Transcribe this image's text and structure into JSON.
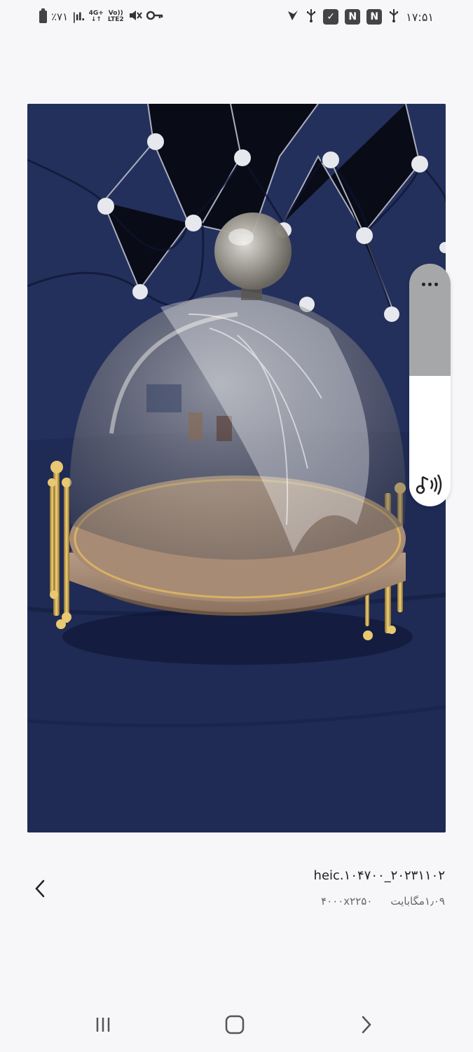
{
  "status_bar": {
    "battery_text": "٪۷۱",
    "net_top": "4G+",
    "net_bottom": "↓↑",
    "volte_top": "Vo))",
    "volte_bottom": "LTE2",
    "time": "۱۷:۵۱"
  },
  "photo": {
    "description_icon": "glass-cloche-photo"
  },
  "side_panel": {
    "more_icon": "more-horiz-icon",
    "sound_icon": "sound-shot-icon"
  },
  "file_info": {
    "filename": "heic.۱۰۴۷۰۰_۲۰۲۳۱۱۰۲",
    "size": "۱٫۰۹مگابایت",
    "dimensions": "۴۰۰۰x۲۲۵۰"
  },
  "colors": {
    "background": "#f7f7f9",
    "panel_gray": "#a6a7a9",
    "fabric_navy": "#1e2a52"
  }
}
